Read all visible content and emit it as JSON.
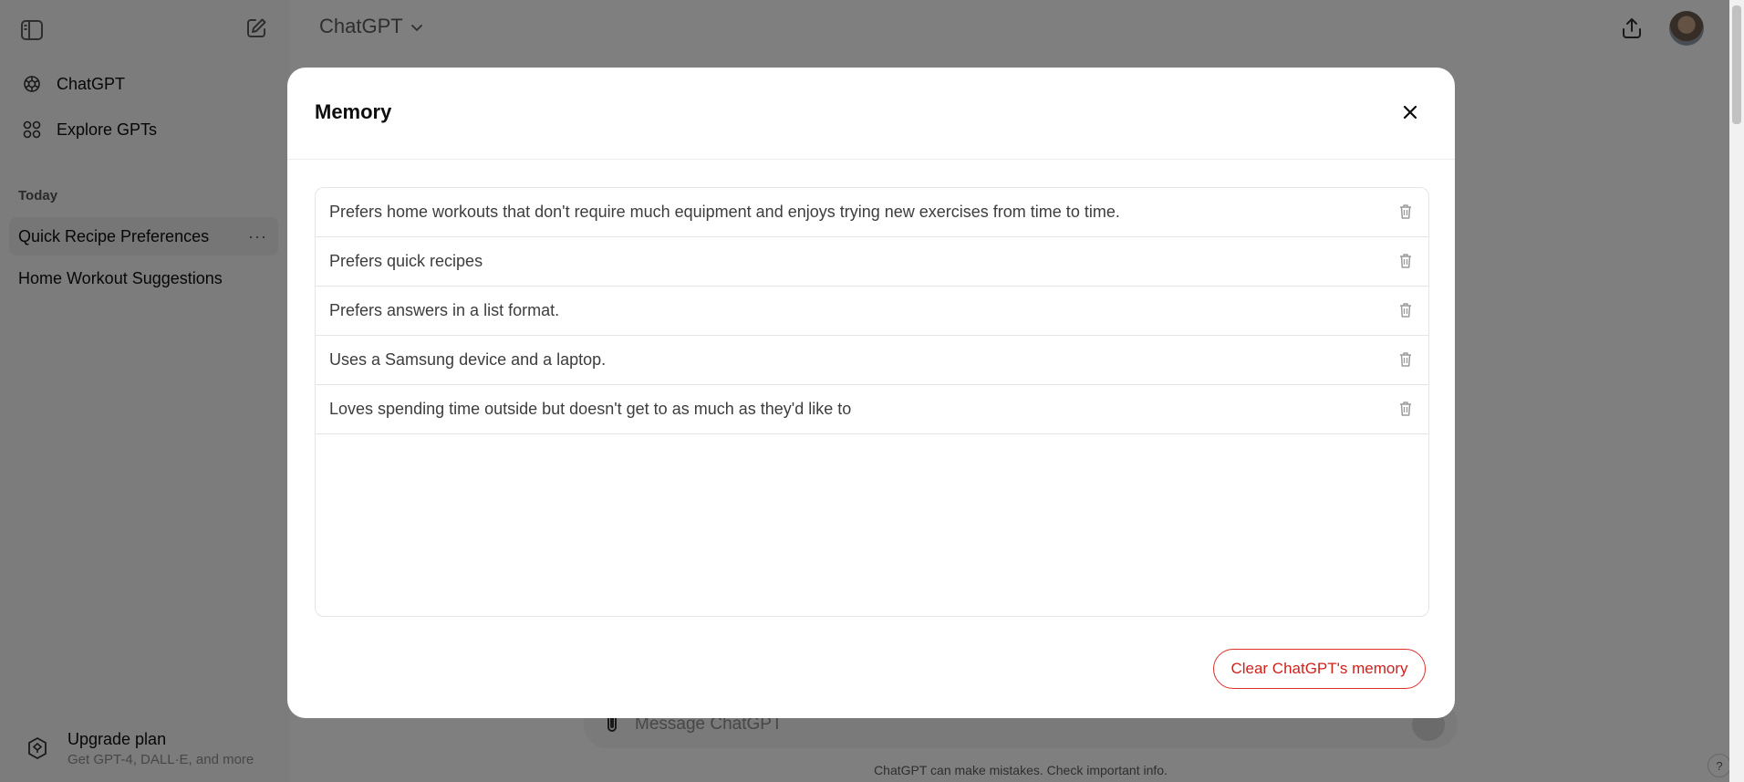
{
  "sidebar": {
    "toggle_icon": "sidebar-toggle-icon",
    "new_chat_icon": "new-chat-icon",
    "nav": [
      {
        "label": "ChatGPT",
        "icon": "openai-logo-icon"
      },
      {
        "label": "Explore GPTs",
        "icon": "grid-icon"
      }
    ],
    "section_label": "Today",
    "history": [
      {
        "label": "Quick Recipe Preferences",
        "more": "···"
      },
      {
        "label": "Home Workout Suggestions"
      }
    ],
    "upgrade": {
      "title": "Upgrade plan",
      "subtitle": "Get GPT-4, DALL·E, and more"
    }
  },
  "header": {
    "model_name": "ChatGPT",
    "share_icon": "share-icon"
  },
  "composer": {
    "placeholder": "Message ChatGPT",
    "disclaimer": "ChatGPT can make mistakes. Check important info.",
    "help": "?"
  },
  "modal": {
    "title": "Memory",
    "memories": [
      "Prefers home workouts that don't require much equipment and enjoys trying new exercises from time to time.",
      "Prefers quick recipes",
      "Prefers answers in a list format.",
      "Uses a Samsung device and a laptop.",
      "Loves spending time outside but doesn't get to as much as they'd like to"
    ],
    "clear_button": "Clear ChatGPT's memory"
  },
  "colors": {
    "danger": "#d0211c",
    "overlay": "rgba(0,0,0,0.5)",
    "sidebar_bg": "#f9f9f9"
  }
}
